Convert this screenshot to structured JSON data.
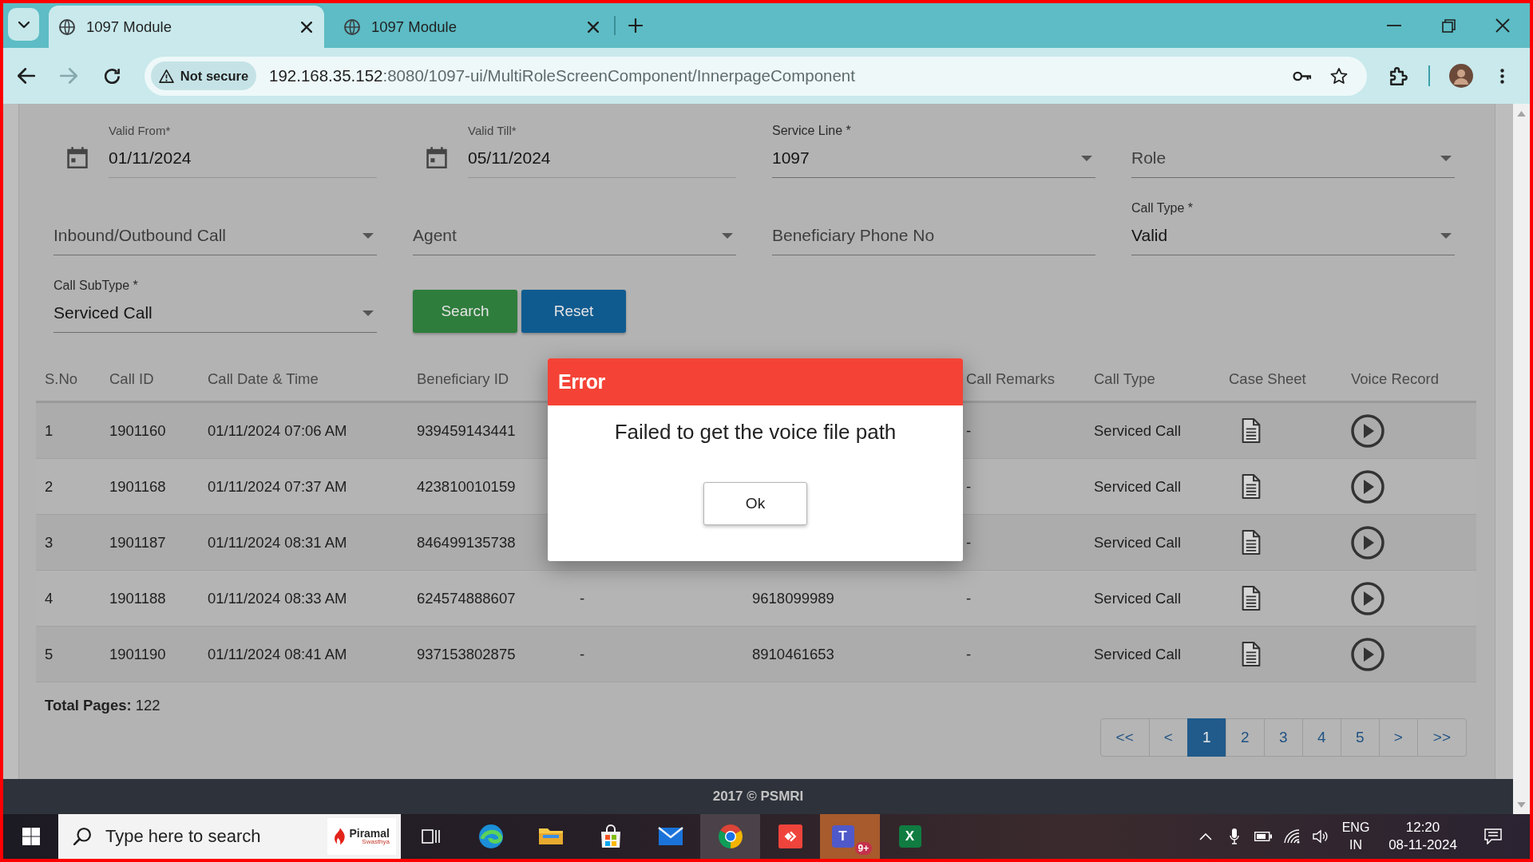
{
  "browser": {
    "tabs": [
      {
        "title": "1097 Module",
        "selected": true
      },
      {
        "title": "1097 Module",
        "selected": false
      }
    ],
    "nav_buttons": [
      {
        "kind": "back",
        "disabled": false
      },
      {
        "kind": "forward",
        "disabled": true
      },
      {
        "kind": "reload",
        "disabled": false
      }
    ],
    "address": {
      "security": "Not secure",
      "host": "192.168.35.152",
      "path": ":8080/1097-ui/MultiRoleScreenComponent/InnerpageComponent"
    }
  },
  "filters": {
    "fields": [
      {
        "kind": "date",
        "label": "Valid From*",
        "value": "01/11/2024"
      },
      {
        "kind": "date",
        "label": "Valid Till*",
        "value": "05/11/2024"
      },
      {
        "kind": "select",
        "label": "Service Line *",
        "value": "1097"
      },
      {
        "kind": "select",
        "placeholder": "Role"
      },
      {
        "kind": "select",
        "placeholder": "Inbound/Outbound Call"
      },
      {
        "kind": "select",
        "placeholder": "Agent"
      },
      {
        "kind": "input",
        "placeholder": "Beneficiary Phone No"
      },
      {
        "kind": "select",
        "label": "Call Type *",
        "value": "Valid"
      },
      {
        "kind": "select",
        "label": "Call SubType *",
        "value": "Serviced Call"
      }
    ],
    "buttons": [
      {
        "label": "Search",
        "kind": "primary"
      },
      {
        "label": "Reset",
        "kind": "secondary"
      }
    ]
  },
  "table": {
    "header": {
      "s_no": "S.No",
      "call_id": "Call ID",
      "call_date_time": "Call Date & Time",
      "beneficiary_id": "Beneficiary ID",
      "call_remarks": "Call Remarks",
      "call_type": "Call Type",
      "case_sheet": "Case Sheet",
      "voice_record": "Voice Record"
    },
    "rows": [
      {
        "s_no": "1",
        "call_id": "1901160",
        "call_date_time": "01/11/2024 07:06 AM",
        "beneficiary_id": "939459143441",
        "call_remarks": "-",
        "call_type": "Serviced Call"
      },
      {
        "s_no": "2",
        "call_id": "1901168",
        "call_date_time": "01/11/2024 07:37 AM",
        "beneficiary_id": "423810010159",
        "call_remarks": "-",
        "call_type": "Serviced Call"
      },
      {
        "s_no": "3",
        "call_id": "1901187",
        "call_date_time": "01/11/2024 08:31 AM",
        "beneficiary_id": "846499135738",
        "call_remarks": "-",
        "call_type": "Serviced Call"
      },
      {
        "s_no": "4",
        "call_id": "1901188",
        "call_date_time": "01/11/2024 08:33 AM",
        "beneficiary_id": "624574888607",
        "column_5": "-",
        "column_6": "9618099989",
        "call_remarks": "-",
        "call_type": "Serviced Call"
      },
      {
        "s_no": "5",
        "call_id": "1901190",
        "call_date_time": "01/11/2024 08:41 AM",
        "beneficiary_id": "937153802875",
        "column_5": "-",
        "column_6": "8910461653",
        "call_remarks": "-",
        "call_type": "Serviced Call"
      }
    ]
  },
  "total_pages": "**Total Pages:** 122",
  "pagination": [
    {
      "label": "<<",
      "selected": false
    },
    {
      "label": "<",
      "selected": false
    },
    {
      "label": "1",
      "selected": true
    },
    {
      "label": "2",
      "selected": false
    },
    {
      "label": "3",
      "selected": false
    },
    {
      "label": "4",
      "selected": false
    },
    {
      "label": "5",
      "selected": false
    },
    {
      "label": ">",
      "selected": false
    },
    {
      "label": ">>",
      "selected": false
    }
  ],
  "footer": "2017 © PSMRI",
  "dialog": {
    "title": "Error",
    "message": "Failed to get the voice file path",
    "button": "Ok"
  },
  "taskbar": {
    "search": {
      "placeholder": "Type here to search",
      "logo_text": "Piramal",
      "logo_subtext": "Swasthya"
    },
    "apps": [
      {
        "kind": "task_view",
        "active": false,
        "attention": false
      },
      {
        "kind": "edge",
        "active": false,
        "attention": false
      },
      {
        "kind": "explorer",
        "active": false,
        "attention": false
      },
      {
        "kind": "store",
        "active": false,
        "attention": false
      },
      {
        "kind": "mail",
        "active": false,
        "attention": false
      },
      {
        "kind": "chrome",
        "active": true,
        "attention": false
      },
      {
        "kind": "remote",
        "active": false,
        "attention": false
      },
      {
        "kind": "teams",
        "active": false,
        "attention": true,
        "glyph": "T",
        "badge": "9+"
      },
      {
        "kind": "excel",
        "active": false,
        "attention": false,
        "glyph": "X"
      }
    ],
    "tray": {
      "language": "ENG",
      "region": "IN",
      "time": "12:20",
      "date": "08-11-2024"
    }
  }
}
